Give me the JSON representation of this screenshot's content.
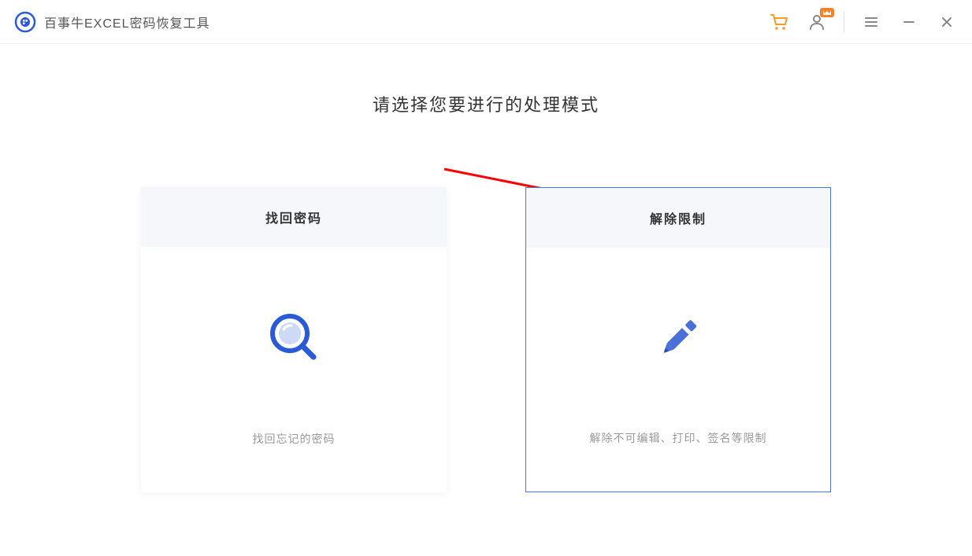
{
  "header": {
    "title": "百事牛EXCEL密码恢复工具"
  },
  "main": {
    "heading": "请选择您要进行的处理模式"
  },
  "cards": {
    "recover": {
      "title": "找回密码",
      "description": "找回忘记的密码"
    },
    "unlock": {
      "title": "解除限制",
      "description": "解除不可编辑、打印、签名等限制"
    }
  }
}
